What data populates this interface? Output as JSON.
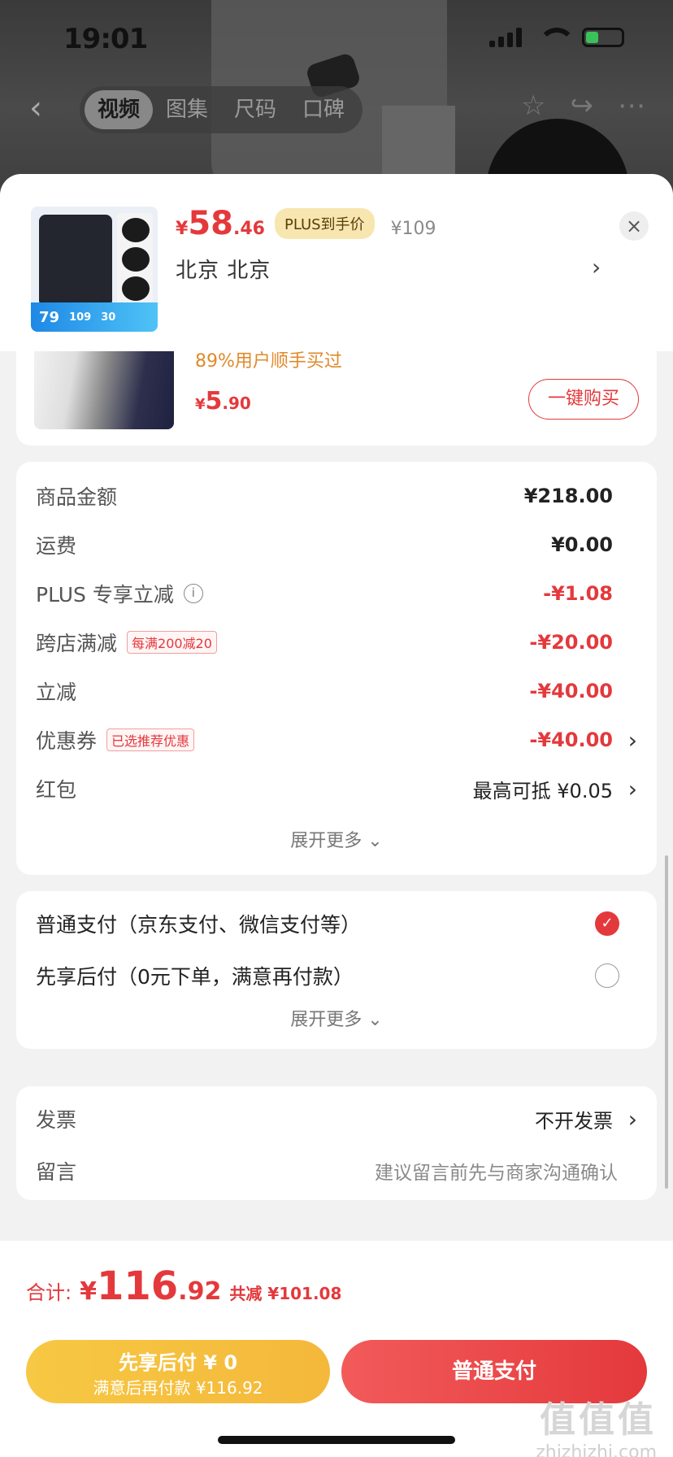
{
  "status_bar": {
    "time": "19:01"
  },
  "top_nav": {
    "tabs": [
      "视频",
      "图集",
      "尺码",
      "口碑"
    ],
    "back": "‹"
  },
  "header": {
    "price_symbol": "¥",
    "price_int": "58",
    "price_dec": ".46",
    "plus_badge": "PLUS到手价",
    "original_price": "¥109",
    "address": "北京  北京",
    "address_chevron": "›",
    "close": "×",
    "thumb_strip": [
      "79",
      "109",
      "30"
    ]
  },
  "upsell": {
    "bought_text": "89%用户顺手买过",
    "price_symbol": "¥",
    "price_int": "5",
    "price_dec": ".90",
    "buy_label": "一键购买"
  },
  "fees": {
    "rows": [
      {
        "label": "商品金额",
        "value": "¥218.00"
      },
      {
        "label": "运费",
        "value": "¥0.00"
      },
      {
        "label": "PLUS 专享立减",
        "value": "-¥1.08"
      },
      {
        "label": "跨店满减",
        "tag": "每满200减20",
        "value": "-¥20.00"
      },
      {
        "label": "立减",
        "value": "-¥40.00"
      },
      {
        "label": "优惠券",
        "tag": "已选推荐优惠",
        "value": "-¥40.00"
      },
      {
        "label": "红包",
        "value": "最高可抵 ¥0.05"
      }
    ],
    "expand_label": "展开更多 ⌄"
  },
  "payment": {
    "options": [
      {
        "label": "普通支付（京东支付、微信支付等）",
        "selected": true
      },
      {
        "label": "先享后付（0元下单，满意再付款）",
        "selected": false
      }
    ],
    "expand_label": "展开更多 ⌄"
  },
  "invoice": {
    "label": "发票",
    "value": "不开发票",
    "message_label": "留言",
    "message_placeholder": "建议留言前先与商家沟通确认"
  },
  "bottom": {
    "total_label": "合计:",
    "total_symbol": "¥",
    "total_int": "116",
    "total_dec": ".92",
    "saved": "共减 ¥101.08",
    "later_line1": "先享后付 ¥ 0",
    "later_line2": "满意后再付款 ¥116.92",
    "pay_label": "普通支付"
  },
  "watermark": {
    "big": "值值值",
    "small": "zhizhizhi.com"
  },
  "colors": {
    "accent": "#e4393c",
    "plus": "#f8e6b0",
    "later": "#f7c843"
  }
}
